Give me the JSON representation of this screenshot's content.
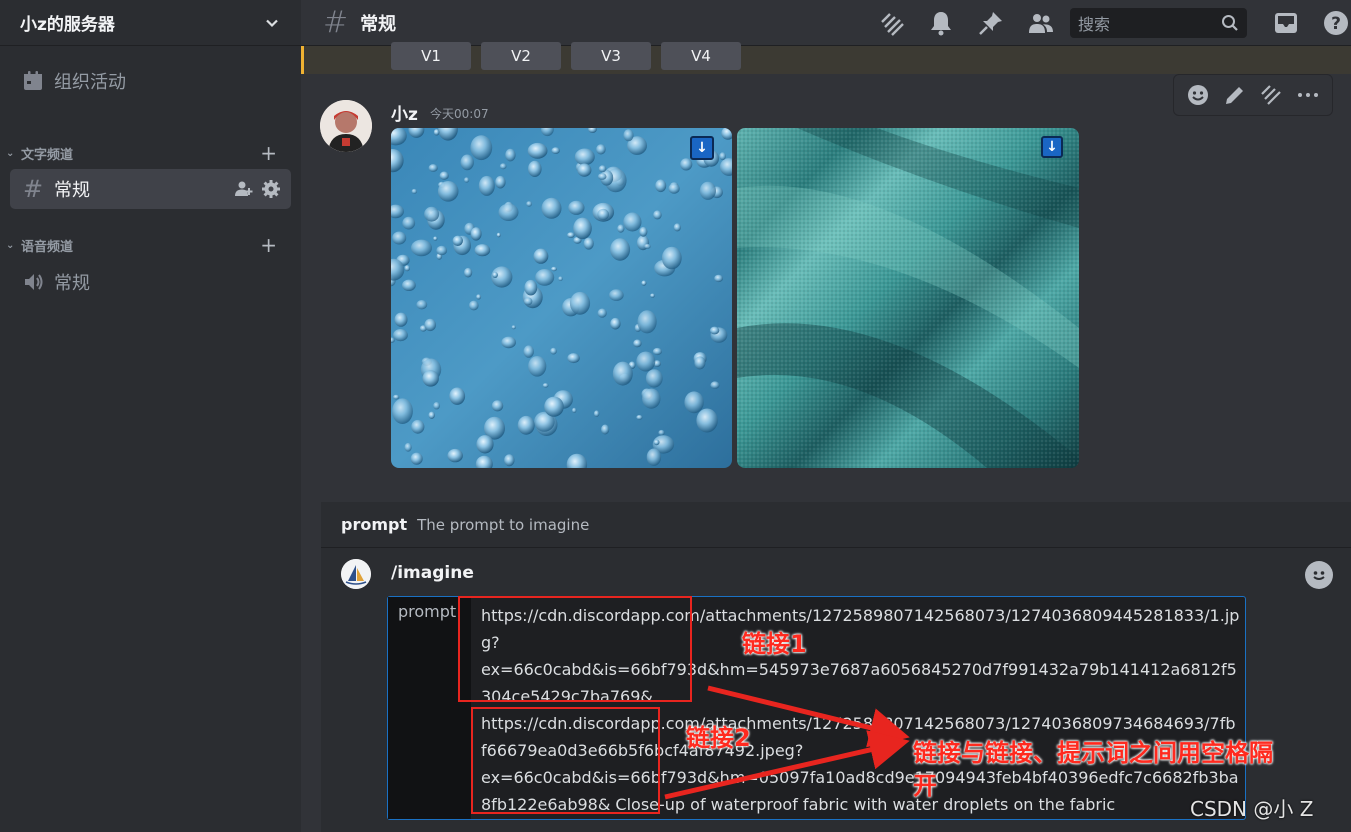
{
  "sidebar": {
    "server_name": "小z的服务器",
    "events_label": "组织活动",
    "text_category": "文字频道",
    "voice_category": "语音频道",
    "text_channel": "常规",
    "voice_channel": "常规"
  },
  "topbar": {
    "channel_name": "常规",
    "search_placeholder": "搜索"
  },
  "upscale_buttons": [
    "V1",
    "V2",
    "V3",
    "V4"
  ],
  "message": {
    "author": "小z",
    "timestamp": "今天00:07"
  },
  "prompt_hint": {
    "option": "prompt",
    "description": "The prompt to imagine"
  },
  "composer": {
    "command": "/imagine",
    "option_label": "prompt",
    "lines": [
      "https://cdn.discordapp.com/attachments/1272589807142568073/1274036809445281833/1.jpg?",
      "ex=66c0cabd&is=66bf793d&hm=545973e7687a6056845270d7f991432a79b141412a6812f5304ce5429c7ba769&",
      "https://cdn.discordapp.com/attachments/1272589807142568073/1274036809734684693/7fbf66679ea0d3e66b5f6bcf4af87492.jpeg?",
      "ex=66c0cabd&is=66bf793d&hm=05097fa10ad8cd9e17094943feb4bf40396edfc7c6682fb3ba8fb122e6ab98&  Close-up of waterproof fabric with water droplets on the fabric"
    ]
  },
  "annotations": {
    "link1": "链接1",
    "link2": "链接2",
    "note": "链接与链接、提示词之间用空格隔",
    "note_cont": "开"
  },
  "watermark": "CSDN @小 Z",
  "colors": {
    "accent": "#1a71c4",
    "annotation_red": "#e8251f",
    "sidebar_bg": "#2b2d31",
    "chat_bg": "#313338"
  }
}
